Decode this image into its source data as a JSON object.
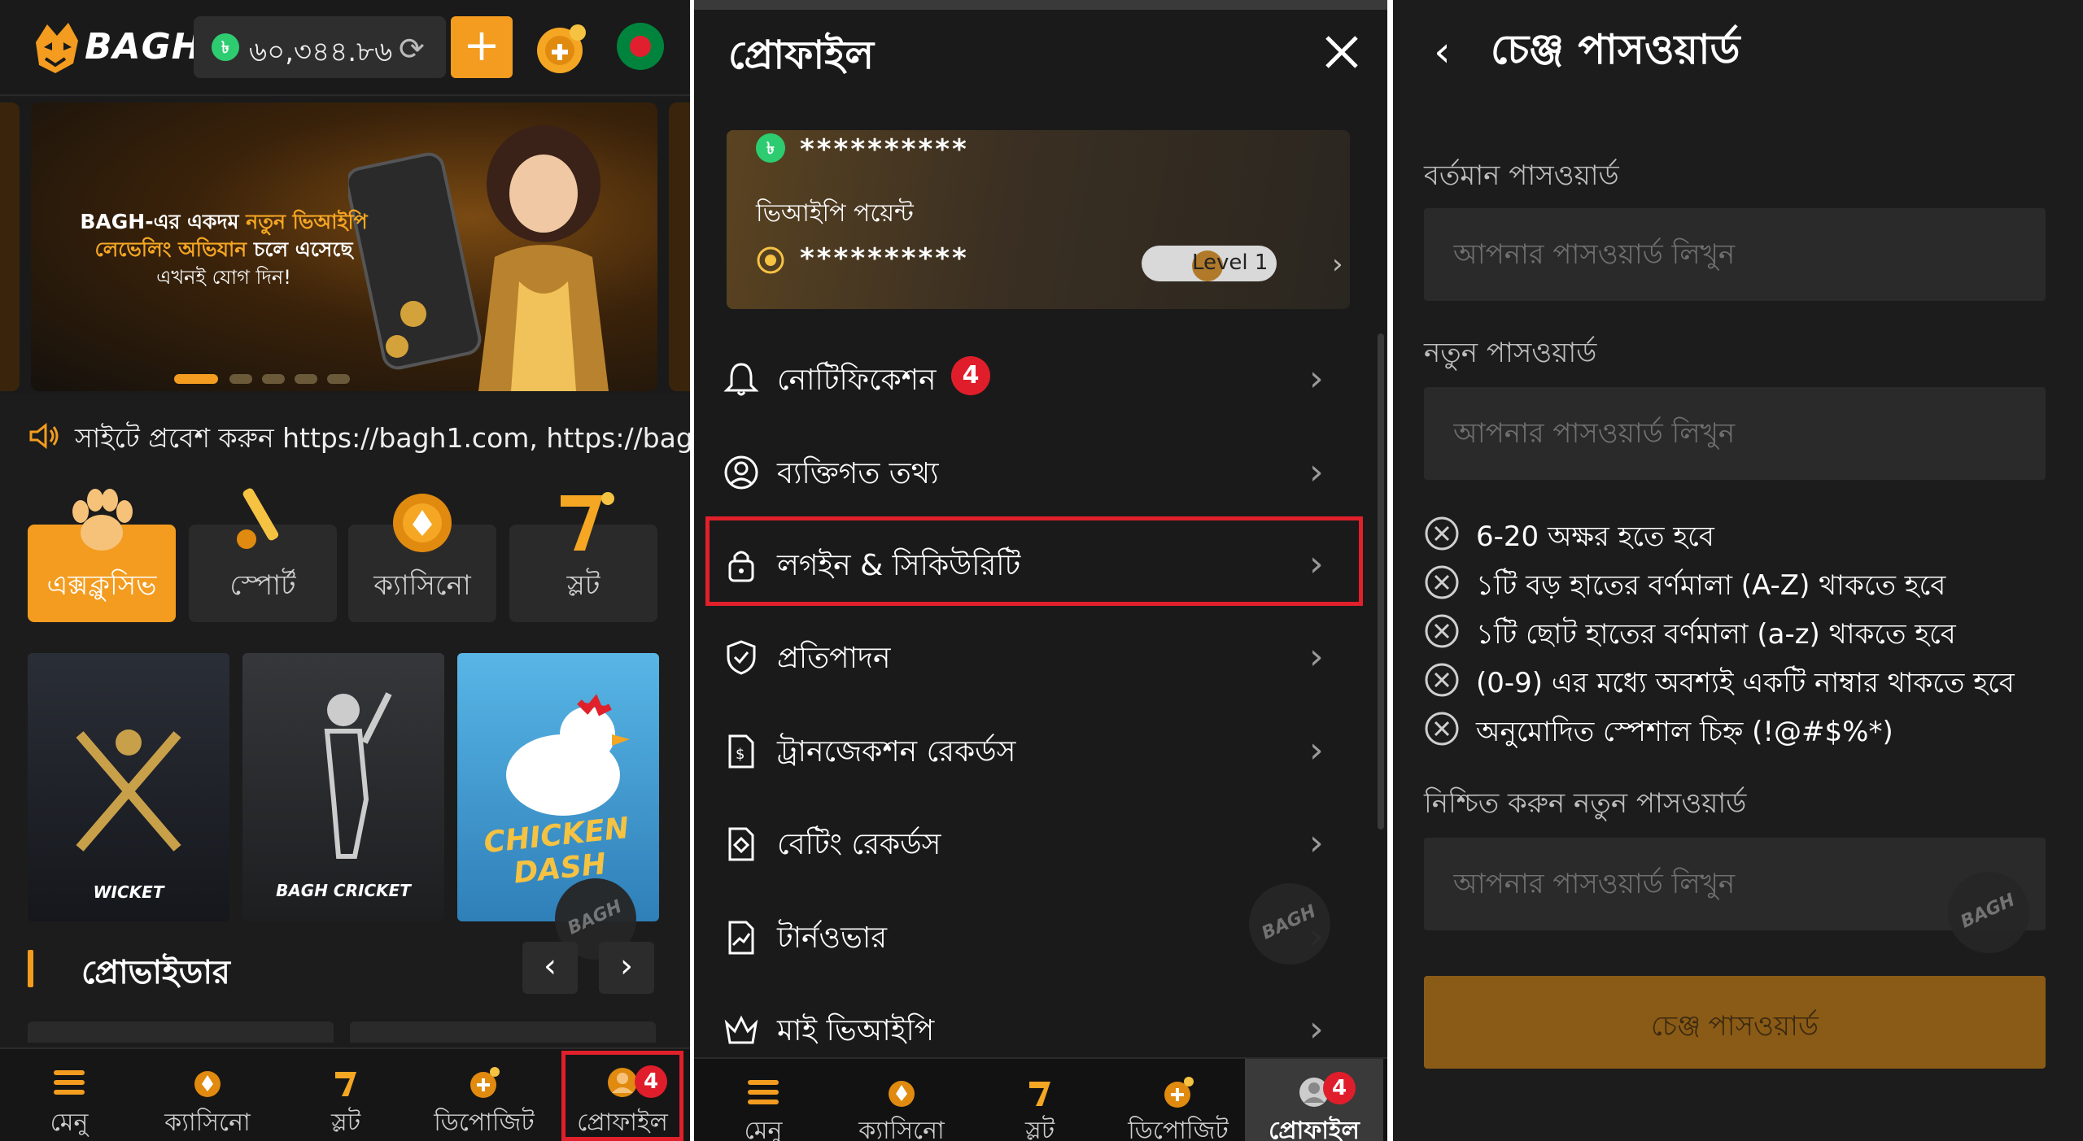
{
  "panel_home": {
    "logo_text": "BAGH",
    "balance_currency": "৳",
    "balance": "৬০,৩৪৪.৮৬",
    "banner": {
      "line1_prefix": "BAGH-এর একদম ",
      "line1_highlight": "নতুন ভিআইপি",
      "line2_highlight": "লেভেলিং অভিযান",
      "line2_rest": " চলে এসেছে",
      "line3": "এখনই যোগ দিন!"
    },
    "marquee": "সাইটে প্রবেশ করুন https://bagh1.com, https://bagh",
    "categories": [
      {
        "label": "এক্সক্লুসিভ",
        "active": true
      },
      {
        "label": "স্পোর্ট",
        "active": false
      },
      {
        "label": "ক্যাসিনো",
        "active": false
      },
      {
        "label": "স্লট",
        "active": false
      }
    ],
    "tiles": [
      {
        "label": "WICKET"
      },
      {
        "label": "BAGH CRICKET"
      },
      {
        "label": "CHICKEN DASH"
      }
    ],
    "providers_title": "প্রোভাইডার",
    "bottom_nav": [
      {
        "label": "মেনু"
      },
      {
        "label": "ক্যাসিনো"
      },
      {
        "label": "স্লট"
      },
      {
        "label": "ডিপোজিট"
      },
      {
        "label": "প্রোফাইল",
        "badge": "4"
      }
    ]
  },
  "panel_profile": {
    "title": "প্রোফাইল",
    "masked_balance": "**********",
    "vip_points_label": "ভিআইপি পয়েন্ট",
    "masked_points": "**********",
    "level": "Level 1",
    "menu": [
      {
        "label": "নোটিফিকেশন",
        "badge": "4"
      },
      {
        "label": "ব্যক্তিগত তথ্য"
      },
      {
        "label": "লগইন & সিকিউরিটি"
      },
      {
        "label": "প্রতিপাদন"
      },
      {
        "label": "ট্রানজেকশন রেকর্ডস"
      },
      {
        "label": "বেটিং রেকর্ডস"
      },
      {
        "label": "টার্নওভার"
      },
      {
        "label": "মাই ভিআইপি"
      }
    ],
    "bottom_nav": [
      {
        "label": "মেনু"
      },
      {
        "label": "ক্যাসিনো"
      },
      {
        "label": "স্লট"
      },
      {
        "label": "ডিপোজিট"
      },
      {
        "label": "প্রোফাইল",
        "badge": "4"
      }
    ]
  },
  "panel_password": {
    "title": "চেঞ্জ পাসওয়ার্ড",
    "current_label": "বর্তমান পাসওয়ার্ড",
    "new_label": "নতুন পাসওয়ার্ড",
    "confirm_label": "নিশ্চিত করুন নতুন পাসওয়ার্ড",
    "placeholder": "আপনার পাসওয়ার্ড লিখুন",
    "rules": [
      "6-20 অক্ষর হতে হবে",
      "১টি বড় হাতের বর্ণমালা (A-Z) থাকতে হবে",
      "১টি ছোট হাতের বর্ণমালা (a-z) থাকতে হবে",
      "(0-9) এর মধ্যে অবশ্যই একটি নাম্বার থাকতে হবে",
      "অনুমোদিত স্পেশাল চিহ্ন (!@#$%*)"
    ],
    "submit_label": "চেঞ্জ পাসওয়ার্ড"
  },
  "colors": {
    "accent_orange": "#f39c1f",
    "badge_red": "#e01e2b",
    "highlight_frame": "#e0202a",
    "button_brown": "#8a5b16"
  }
}
